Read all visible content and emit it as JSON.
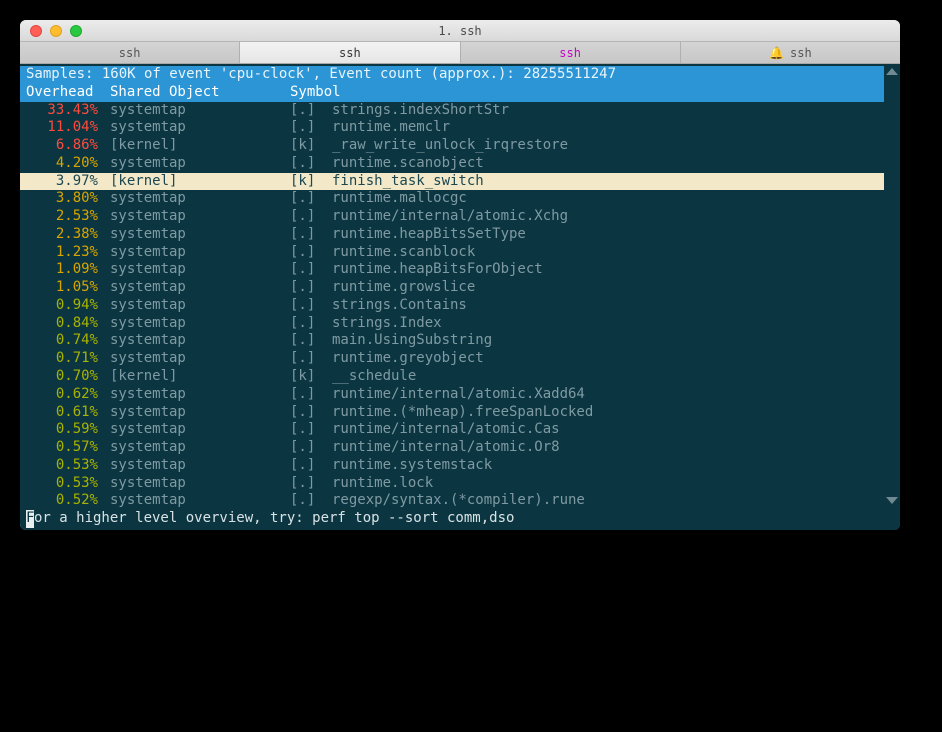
{
  "window": {
    "title": "1. ssh"
  },
  "tabs": [
    {
      "label": "ssh",
      "active": false,
      "highlight": false,
      "bell": false
    },
    {
      "label": "ssh",
      "active": true,
      "highlight": false,
      "bell": false
    },
    {
      "label": "ssh",
      "active": false,
      "highlight": true,
      "bell": false
    },
    {
      "label": "ssh",
      "active": false,
      "highlight": false,
      "bell": true
    }
  ],
  "status": "Samples: 160K of event 'cpu-clock', Event count (approx.): 28255511247",
  "columns": {
    "overhead": "Overhead",
    "object": "Shared Object",
    "symbol": "Symbol"
  },
  "colors": {
    "hot": "#ff4b3e",
    "warm": "#d8a400",
    "cool": "#a8b200"
  },
  "rows": [
    {
      "pct": "33.43%",
      "heat": "hot",
      "obj": "systemtap",
      "tag": "[.]",
      "sym": "strings.indexShortStr",
      "sel": false
    },
    {
      "pct": "11.04%",
      "heat": "hot",
      "obj": "systemtap",
      "tag": "[.]",
      "sym": "runtime.memclr",
      "sel": false
    },
    {
      "pct": "6.86%",
      "heat": "hot",
      "obj": "[kernel]",
      "tag": "[k]",
      "sym": "_raw_write_unlock_irqrestore",
      "sel": false
    },
    {
      "pct": "4.20%",
      "heat": "warm",
      "obj": "systemtap",
      "tag": "[.]",
      "sym": "runtime.scanobject",
      "sel": false
    },
    {
      "pct": "3.97%",
      "heat": "warm",
      "obj": "[kernel]",
      "tag": "[k]",
      "sym": "finish_task_switch",
      "sel": true
    },
    {
      "pct": "3.80%",
      "heat": "warm",
      "obj": "systemtap",
      "tag": "[.]",
      "sym": "runtime.mallocgc",
      "sel": false
    },
    {
      "pct": "2.53%",
      "heat": "warm",
      "obj": "systemtap",
      "tag": "[.]",
      "sym": "runtime/internal/atomic.Xchg",
      "sel": false
    },
    {
      "pct": "2.38%",
      "heat": "warm",
      "obj": "systemtap",
      "tag": "[.]",
      "sym": "runtime.heapBitsSetType",
      "sel": false
    },
    {
      "pct": "1.23%",
      "heat": "warm",
      "obj": "systemtap",
      "tag": "[.]",
      "sym": "runtime.scanblock",
      "sel": false
    },
    {
      "pct": "1.09%",
      "heat": "warm",
      "obj": "systemtap",
      "tag": "[.]",
      "sym": "runtime.heapBitsForObject",
      "sel": false
    },
    {
      "pct": "1.05%",
      "heat": "warm",
      "obj": "systemtap",
      "tag": "[.]",
      "sym": "runtime.growslice",
      "sel": false
    },
    {
      "pct": "0.94%",
      "heat": "cool",
      "obj": "systemtap",
      "tag": "[.]",
      "sym": "strings.Contains",
      "sel": false
    },
    {
      "pct": "0.84%",
      "heat": "cool",
      "obj": "systemtap",
      "tag": "[.]",
      "sym": "strings.Index",
      "sel": false
    },
    {
      "pct": "0.74%",
      "heat": "cool",
      "obj": "systemtap",
      "tag": "[.]",
      "sym": "main.UsingSubstring",
      "sel": false
    },
    {
      "pct": "0.71%",
      "heat": "cool",
      "obj": "systemtap",
      "tag": "[.]",
      "sym": "runtime.greyobject",
      "sel": false
    },
    {
      "pct": "0.70%",
      "heat": "cool",
      "obj": "[kernel]",
      "tag": "[k]",
      "sym": "__schedule",
      "sel": false
    },
    {
      "pct": "0.62%",
      "heat": "cool",
      "obj": "systemtap",
      "tag": "[.]",
      "sym": "runtime/internal/atomic.Xadd64",
      "sel": false
    },
    {
      "pct": "0.61%",
      "heat": "cool",
      "obj": "systemtap",
      "tag": "[.]",
      "sym": "runtime.(*mheap).freeSpanLocked",
      "sel": false
    },
    {
      "pct": "0.59%",
      "heat": "cool",
      "obj": "systemtap",
      "tag": "[.]",
      "sym": "runtime/internal/atomic.Cas",
      "sel": false
    },
    {
      "pct": "0.57%",
      "heat": "cool",
      "obj": "systemtap",
      "tag": "[.]",
      "sym": "runtime/internal/atomic.Or8",
      "sel": false
    },
    {
      "pct": "0.53%",
      "heat": "cool",
      "obj": "systemtap",
      "tag": "[.]",
      "sym": "runtime.systemstack",
      "sel": false
    },
    {
      "pct": "0.53%",
      "heat": "cool",
      "obj": "systemtap",
      "tag": "[.]",
      "sym": "runtime.lock",
      "sel": false
    },
    {
      "pct": "0.52%",
      "heat": "cool",
      "obj": "systemtap",
      "tag": "[.]",
      "sym": "regexp/syntax.(*compiler).rune",
      "sel": false
    }
  ],
  "footer": "or a higher level overview, try: perf top --sort comm,dso",
  "footer_first_char": "F"
}
